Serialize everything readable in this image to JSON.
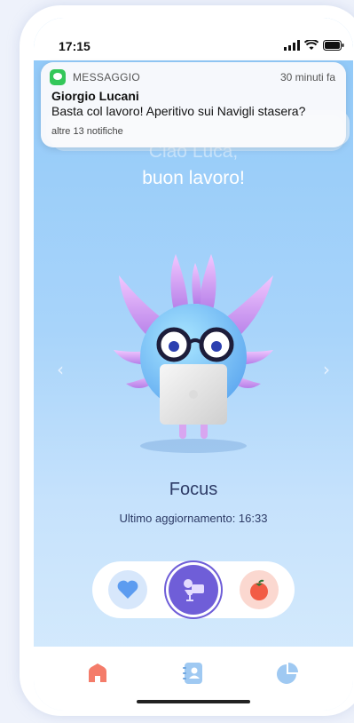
{
  "status_bar": {
    "time": "17:15"
  },
  "notification": {
    "app": "MESSAGGIO",
    "time_ago": "30 minuti fa",
    "sender": "Giorgio Lucani",
    "message": "Basta col lavoro! Aperitivo sui Navigli stasera?",
    "more": "altre 13 notifiche"
  },
  "greeting": {
    "line1": "Ciao Luca,",
    "line2": "buon lavoro!"
  },
  "mood": {
    "title": "Focus",
    "updated": "Ultimo aggiornamento: 16:33"
  },
  "carousel": {
    "prev": "‹",
    "next": "›"
  },
  "mood_buttons": [
    {
      "icon": "heart-icon"
    },
    {
      "icon": "focus-icon",
      "selected": true
    },
    {
      "icon": "tomato-icon"
    }
  ],
  "tabs": [
    {
      "icon": "home-icon",
      "active": true
    },
    {
      "icon": "contacts-book-icon"
    },
    {
      "icon": "pie-chart-icon"
    }
  ],
  "colors": {
    "accent": "#6f5ed8",
    "home_active": "#f47c6a",
    "tab_inactive": "#9fc9f2",
    "heart": "#5c9cf0",
    "tomato": "#f25c45"
  }
}
